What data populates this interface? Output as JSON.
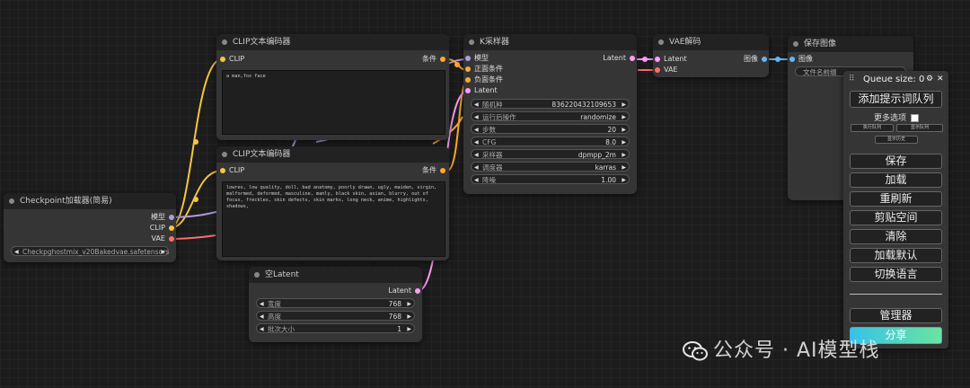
{
  "nodes": {
    "clip1": {
      "title": "CLIP文本编码器",
      "in_clip": "CLIP",
      "out_cond": "条件",
      "text": "a man,fox face"
    },
    "clip2": {
      "title": "CLIP文本编码器",
      "in_clip": "CLIP",
      "out_cond": "条件",
      "text": "lowres, low quality, doll, bad anatomy, poorly drawn, ugly, maiden, virgin, malformed, deformed, masculine, manly, black skin, asian, blurry, out of focus, freckles, skin defects, skin marks, long neck, anime, highlights, shadows,"
    },
    "ksampler": {
      "title": "K采样器",
      "in_model": "模型",
      "in_pos": "正面条件",
      "in_neg": "负面条件",
      "in_latent": "Latent",
      "out_latent": "Latent",
      "widgets": [
        {
          "label": "随机种",
          "value": "836220432109653"
        },
        {
          "label": "运行后操作",
          "value": "randomize"
        },
        {
          "label": "步数",
          "value": "20"
        },
        {
          "label": "CFG",
          "value": "8.0"
        },
        {
          "label": "采样器",
          "value": "dpmpp_2m"
        },
        {
          "label": "调度器",
          "value": "karras"
        },
        {
          "label": "降噪",
          "value": "1.00"
        }
      ]
    },
    "vae": {
      "title": "VAE解码",
      "in_latent": "Latent",
      "in_vae": "VAE",
      "out_image": "图像"
    },
    "save": {
      "title": "保存图像",
      "in_image": "图像",
      "prefix_label": "文件名前缀"
    },
    "checkpoint": {
      "title": "Checkpoint加载器(简易)",
      "out_model": "模型",
      "out_clip": "CLIP",
      "out_vae": "VAE",
      "ckpt_value": "Checkpghostmix_v20Bakedvae.safetensors"
    },
    "empty_latent": {
      "title": "空Latent",
      "out_latent": "Latent",
      "widgets": [
        {
          "label": "宽度",
          "value": "768"
        },
        {
          "label": "高度",
          "value": "768"
        },
        {
          "label": "批次大小",
          "value": "1"
        }
      ]
    }
  },
  "queue_panel": {
    "queue_size": "Queue size: 0",
    "gear": "⚙",
    "close": "✕",
    "add_queue": "添加提示词队列",
    "more_options": "更多选项",
    "exec_queue": "执行队列",
    "show_queue": "显示队列",
    "show_history": "显示历史",
    "save": "保存",
    "load": "加载",
    "refresh": "重刷新",
    "clipspace": "剪贴空间",
    "clear": "清除",
    "load_default": "加载默认",
    "switch_lang": "切换语言",
    "manager": "管理器",
    "share": "分享"
  },
  "watermark": "公众号 · AI模型栈",
  "colors": {
    "clip_wire": "#f5c542",
    "model_wire": "#b39ddb",
    "vae_wire": "#ff6e6e",
    "latent_wire": "#ff9cf9",
    "cond_wire": "#ffa931",
    "image_wire": "#64b5f6"
  }
}
